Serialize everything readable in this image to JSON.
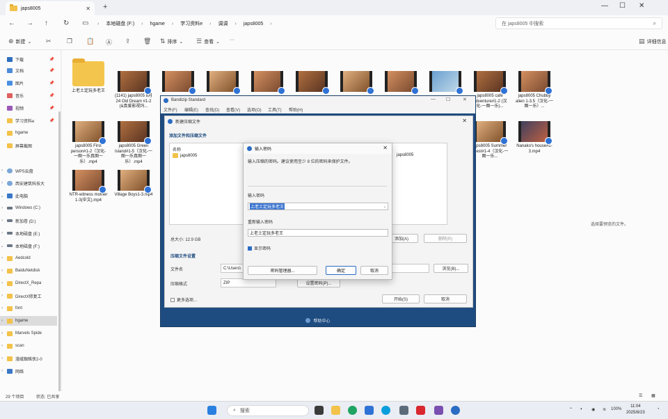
{
  "explorer": {
    "tab_title": "japs8005",
    "nav": {
      "back": "←",
      "forward": "→",
      "up": "↑",
      "refresh": "↻"
    },
    "breadcrumbs": [
      "本地磁盘 (F:)",
      "hgame",
      "学习资料e",
      "调调",
      "japs8005"
    ],
    "search_placeholder": "在 japs8005 中搜索",
    "toolbar": {
      "new": "新建",
      "sort": "排序",
      "view": "查看",
      "more": "···",
      "details": "详细信息"
    },
    "sidebar": [
      "下载",
      "文档",
      "图片",
      "音乐",
      "视频",
      "学习资料e",
      "hgame",
      "屏幕截图",
      "WPS云盘",
      "西安建筑科技大",
      "此电脑",
      "Windows (C:)",
      "新加卷 (D:)",
      "本地磁盘 (E:)",
      "本地磁盘 (F:)",
      "Aedcold",
      "BaiduNetdisk",
      "DirectX_Repa",
      "DirectX修复工",
      "font",
      "hgame",
      "Marvels Spide",
      "scan",
      "漫威蜘蛛侠2-0",
      "网络"
    ],
    "files": [
      "上老土定玩多老王",
      "(1141) japs8005 8月24 Old Dream #1-2 (&真爱影视玛...",
      "",
      "",
      "",
      "",
      "",
      "",
      "",
      "japs8005 cafe Adventure#1-2 (汉化-一图一乐)...",
      "japs8005 Chubby alien 1-3.5（汉化-一图一乐）...",
      "japs8005 First person#1-2（汉化-一图一乐真图一乐）.mp4",
      "japs8005 Green Island#1-5（汉化-一图一乐真图一乐）.mp4",
      "japs8005 Summer quest#1-4（汉化-一图一乐...",
      "Nanako's house#1-3.mp4",
      "NTR-witness mother 1-3(中文).mp4",
      "Village Boys1-3.mp4"
    ],
    "empty_hint": "选择要预览的文件。",
    "status": {
      "count": "29 个项目",
      "state": "状态: 已共享"
    }
  },
  "bandizip": {
    "title": "Bandizip Standard",
    "menu": [
      "文件(F)",
      "编辑(E)",
      "查找(D)",
      "查看(V)",
      "选项(O)",
      "工具(T)",
      "帮助(H)"
    ],
    "footer": "帮助中心"
  },
  "new_archive": {
    "title": "新建压缩文件",
    "heading": "添加文件和压缩文件",
    "list_header": "名称",
    "list_item": "japs8005",
    "list_col2": "japs8005",
    "total_size": "总大小: 12.9 GB",
    "add_btn": "添加(A)",
    "remove_btn": "删除(R)",
    "section2": "压缩文件设置",
    "file_name_label": "文件名",
    "file_name_value": "C:\\Users\\",
    "browse_btn": "浏览(B)...",
    "format_label": "压缩格式",
    "format_value": "ZIP",
    "password_btn": "设置密码(P)...",
    "more_options": "更多选项...",
    "start_btn": "开始(S)",
    "cancel_btn": "取消"
  },
  "password_dialog": {
    "title": "输入密码",
    "description": "输入压缩的密码。建议使用至少 8 位的密码来保护文件。",
    "enter_label": "输入密码",
    "enter_value": "上老土定玩多老王",
    "reenter_label": "重新输入密码",
    "reenter_value": "上老土定玩多老王",
    "show_password": "显示密码",
    "manager_btn": "密码管理器...",
    "ok_btn": "确定",
    "cancel_btn": "取消"
  },
  "taskbar": {
    "search_placeholder": "搜索",
    "battery": "100%",
    "time": "11:04",
    "date": "2025/8/23"
  }
}
